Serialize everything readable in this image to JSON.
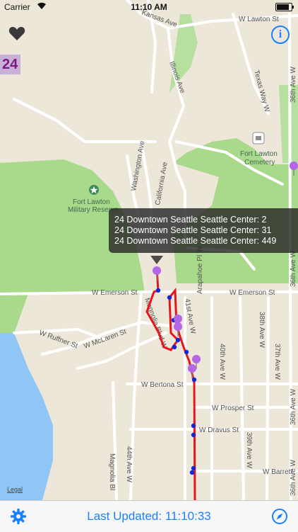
{
  "status_bar": {
    "carrier": "Carrier",
    "time": "11:10 AM",
    "battery_level": 0.85
  },
  "map": {
    "streets": {
      "kansas_ave": "Kansas Ave",
      "w_lawton_st": "W Lawton St",
      "illinois_ave": "Illinois Ave",
      "texas_way_w": "Texas Way W",
      "36th_ave_w_top": "36th Ave W",
      "36th_ave_w_mid": "36th Ave W",
      "36th_ave_w_low": "36th Ave W",
      "36th_ave_w_bottom": "36th Ave W",
      "washington_ave": "Washington Ave",
      "california_ave": "California Ave",
      "w_emerson_st_left": "W Emerson St",
      "w_emerson_st_right": "W Emerson St",
      "magnolia_blvd_w": "Magnolia Blvd W",
      "41st_ave_w": "41st Ave W",
      "arapahoe_pl_w": "Arapahoe Pl W",
      "38th_ave_w": "38th Ave W",
      "40th_ave_w": "40th Ave W",
      "37th_ave_w": "37th Ave W",
      "w_ruffner_st": "W Ruffner St",
      "w_mclaren_st": "W McLaren St",
      "w_bertona_st": "W Bertona St",
      "w_prosper_st": "W Prosper St",
      "w_dravus_st": "W Dravus St",
      "44th_ave_w": "44th Ave W",
      "magnolia_bl": "Magnolia Bl",
      "39th_ave_w": "39th Ave W",
      "w_barrett": "W Barrett"
    },
    "pois": {
      "cemetery_line1": "Fort Lawton",
      "cemetery_line2": "Cemetery",
      "military_line1": "Fort Lawton",
      "military_line2": "Military Reserve"
    },
    "colors": {
      "route": "#e8141c",
      "stop": "#1428d8",
      "bus_pin": "#b466e6",
      "park": "#a9d98a",
      "water": "#8fc6f5"
    }
  },
  "toolbar": {
    "route_badge": "24"
  },
  "callout": {
    "lines": [
      "24 Downtown Seattle Seattle Center: 2",
      "24 Downtown Seattle Seattle Center: 31",
      "24 Downtown Seattle Seattle Center: 449"
    ]
  },
  "legal": "Legal",
  "bottom_bar": {
    "last_updated": "Last Updated: 11:10:33"
  },
  "icons": {
    "favorite": "heart-icon",
    "info": "info-icon",
    "settings": "gear-icon",
    "location": "compass-icon"
  }
}
